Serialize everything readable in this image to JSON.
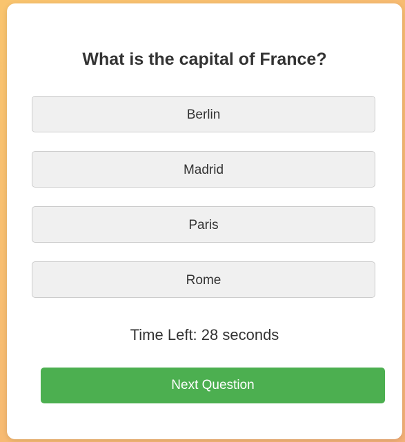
{
  "quiz": {
    "question": "What is the capital of France?",
    "options": [
      "Berlin",
      "Madrid",
      "Paris",
      "Rome"
    ],
    "timer_text": "Time Left: 28 seconds",
    "next_label": "Next Question"
  },
  "colors": {
    "background_gradient": [
      "#f9c46e",
      "#f3b078"
    ],
    "card": "#ffffff",
    "option_bg": "#f0f0f0",
    "option_border": "#cccccc",
    "text": "#333333",
    "next_button": "#4caf50"
  }
}
